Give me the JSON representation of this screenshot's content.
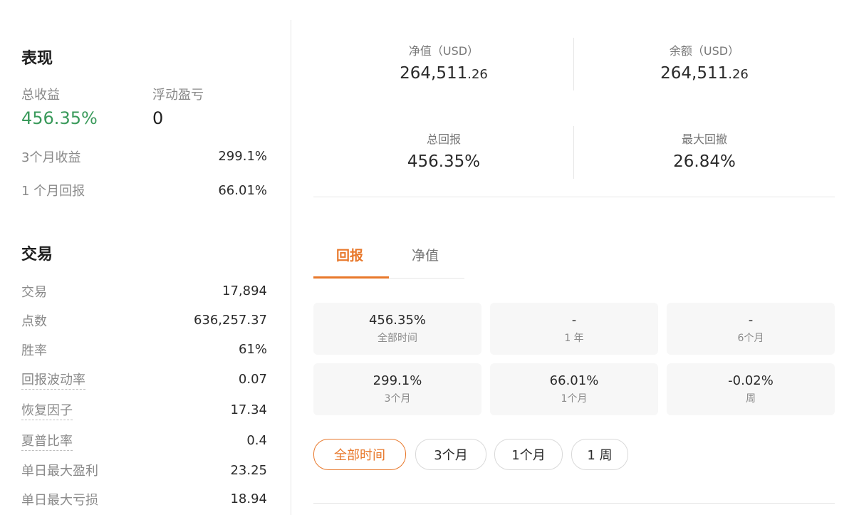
{
  "performance": {
    "title": "表现",
    "total_return_label": "总收益",
    "total_return_value": "456.35%",
    "floating_pnl_label": "浮动盈亏",
    "floating_pnl_value": "0",
    "rows": [
      {
        "label": "3个月收益",
        "value": "299.1%"
      },
      {
        "label": "1 个月回报",
        "value": "66.01%"
      }
    ]
  },
  "trading": {
    "title": "交易",
    "rows": [
      {
        "label": "交易",
        "value": "17,894"
      },
      {
        "label": "点数",
        "value": "636,257.37"
      },
      {
        "label": "胜率",
        "value": "61%"
      },
      {
        "label": "回报波动率",
        "value": "0.07"
      },
      {
        "label": "恢复因子",
        "value": "17.34"
      },
      {
        "label": "夏普比率",
        "value": "0.4"
      },
      {
        "label": "单日最大盈利",
        "value": "23.25"
      },
      {
        "label": "单日最大亏损",
        "value": "18.94"
      }
    ]
  },
  "summary": {
    "equity_label": "净值（USD）",
    "equity_main": "264,511",
    "equity_cents": ".26",
    "balance_label": "余额（USD）",
    "balance_main": "264,511",
    "balance_cents": ".26",
    "total_return_label": "总回报",
    "total_return_value": "456.35%",
    "max_drawdown_label": "最大回撤",
    "max_drawdown_value": "26.84%"
  },
  "tabs": [
    {
      "label": "回报",
      "active": true
    },
    {
      "label": "净值",
      "active": false
    }
  ],
  "return_cards": [
    {
      "value": "456.35%",
      "label": "全部时间"
    },
    {
      "value": "-",
      "label": "1 年"
    },
    {
      "value": "-",
      "label": "6个月"
    },
    {
      "value": "299.1%",
      "label": "3个月"
    },
    {
      "value": "66.01%",
      "label": "1个月"
    },
    {
      "value": "-0.02%",
      "label": "周"
    }
  ],
  "period_buttons": [
    {
      "label": "全部时间",
      "active": true
    },
    {
      "label": "3个月",
      "active": false
    },
    {
      "label": "1个月",
      "active": false
    },
    {
      "label": "1 周",
      "active": false
    }
  ],
  "colors": {
    "accent": "#e8782b",
    "positive": "#3a9a5b"
  }
}
